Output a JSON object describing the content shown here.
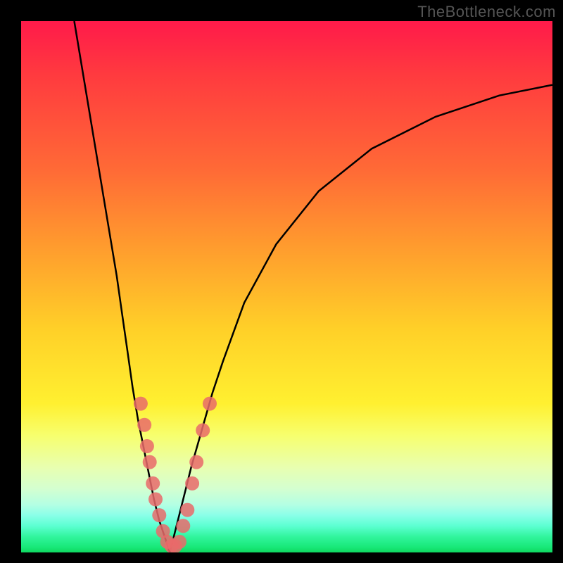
{
  "watermark": "TheBottleneck.com",
  "chart_data": {
    "type": "line",
    "title": "",
    "xlabel": "",
    "ylabel": "",
    "xlim": [
      0,
      100
    ],
    "ylim": [
      0,
      100
    ],
    "grid": false,
    "legend": false,
    "series": [
      {
        "name": "left-branch",
        "x": [
          10,
          12,
          14,
          16,
          18,
          19,
          20,
          21,
          22,
          23,
          24,
          25,
          26,
          27,
          28
        ],
        "y": [
          100,
          88,
          76,
          64,
          52,
          45,
          38,
          31,
          25,
          20,
          15,
          10,
          6,
          3,
          0
        ]
      },
      {
        "name": "right-branch",
        "x": [
          28,
          29,
          30,
          31,
          32,
          34,
          36,
          38,
          42,
          48,
          56,
          66,
          78,
          90,
          100
        ],
        "y": [
          0,
          4,
          8,
          12,
          16,
          23,
          30,
          36,
          47,
          58,
          68,
          76,
          82,
          86,
          88
        ]
      }
    ],
    "scatter": {
      "name": "highlighted-points",
      "color": "#e96a6a",
      "points": [
        {
          "x": 22.5,
          "y": 28
        },
        {
          "x": 23.2,
          "y": 24
        },
        {
          "x": 23.7,
          "y": 20
        },
        {
          "x": 24.2,
          "y": 17
        },
        {
          "x": 24.8,
          "y": 13
        },
        {
          "x": 25.3,
          "y": 10
        },
        {
          "x": 26.0,
          "y": 7
        },
        {
          "x": 26.7,
          "y": 4
        },
        {
          "x": 27.5,
          "y": 2
        },
        {
          "x": 28.3,
          "y": 1.2
        },
        {
          "x": 29.0,
          "y": 1.2
        },
        {
          "x": 29.8,
          "y": 2
        },
        {
          "x": 30.5,
          "y": 5
        },
        {
          "x": 31.3,
          "y": 8
        },
        {
          "x": 32.2,
          "y": 13
        },
        {
          "x": 33.0,
          "y": 17
        },
        {
          "x": 34.2,
          "y": 23
        },
        {
          "x": 35.5,
          "y": 28
        }
      ]
    },
    "gradient_stops": [
      {
        "pos": 0,
        "color": "#ff1a4a"
      },
      {
        "pos": 28,
        "color": "#ff6a36"
      },
      {
        "pos": 58,
        "color": "#ffd028"
      },
      {
        "pos": 78,
        "color": "#f7ff6e"
      },
      {
        "pos": 95,
        "color": "#5cffd2"
      },
      {
        "pos": 100,
        "color": "#0fd860"
      }
    ]
  }
}
